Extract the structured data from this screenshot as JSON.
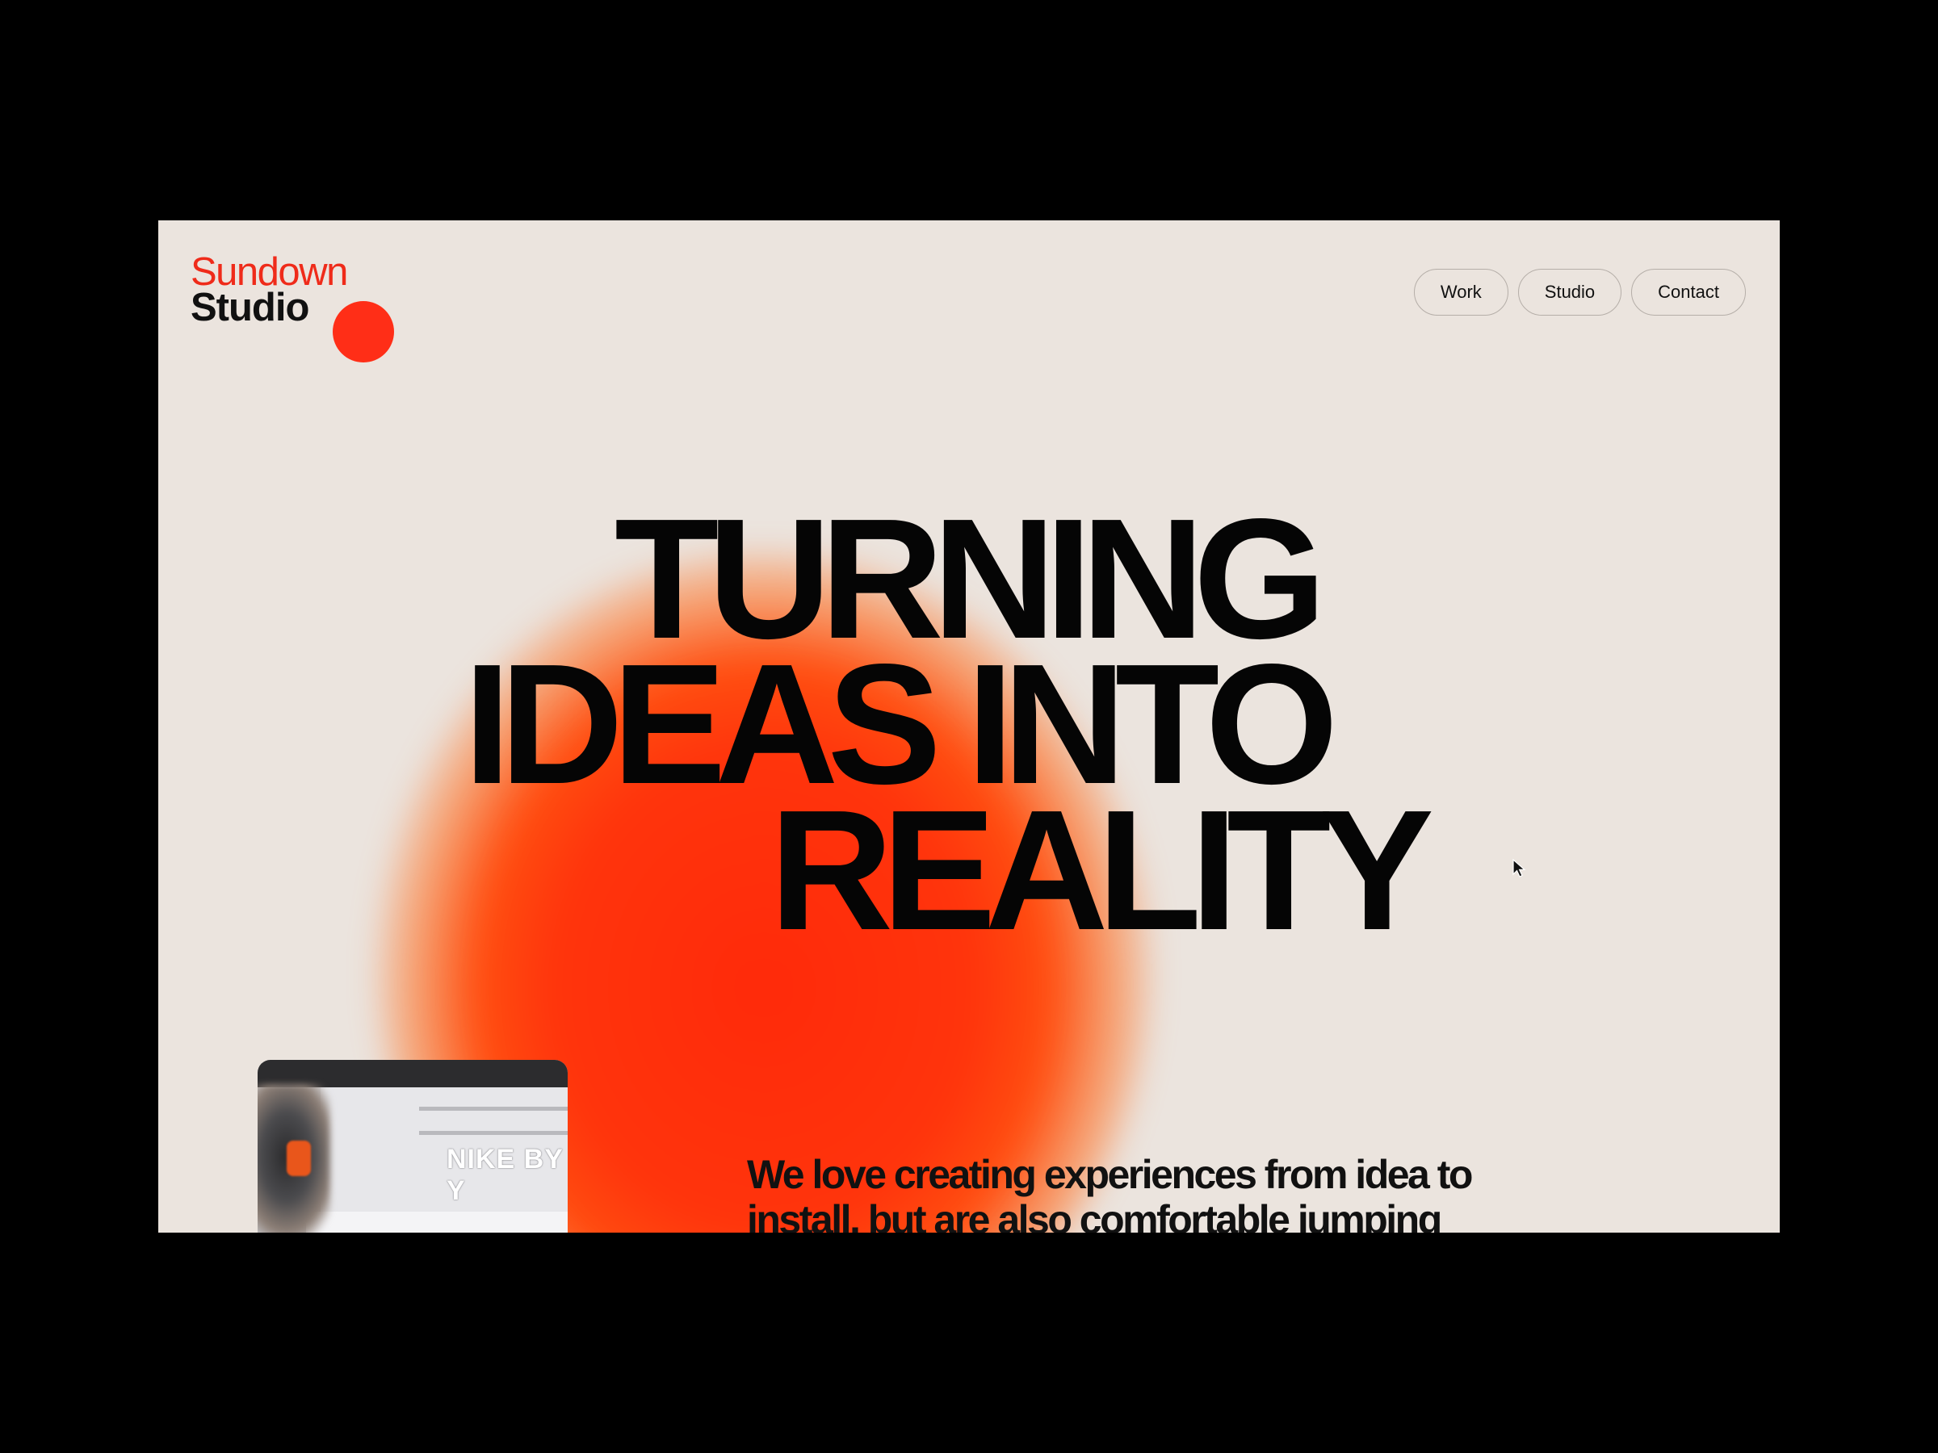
{
  "logo": {
    "line1": "Sundown",
    "line2": "Studio"
  },
  "nav": {
    "work": "Work",
    "studio": "Studio",
    "contact": "Contact"
  },
  "hero": {
    "line1": "TURNING",
    "line2": "IDEAS INTO",
    "line3": "REALITY"
  },
  "thumbnail": {
    "sign": "NIKE BY Y"
  },
  "intro": {
    "text": "We love creating experiences from idea to install, but are also comfortable jumping into a project at any point in"
  },
  "colors": {
    "accent": "#ff2e17",
    "background": "#ebe4de",
    "ink": "#050505"
  },
  "icons": {
    "cursor": "pointer-cursor-icon"
  }
}
